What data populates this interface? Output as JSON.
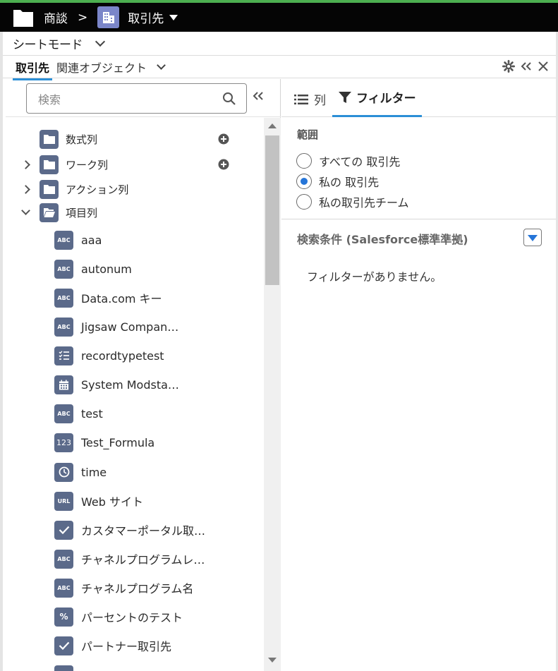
{
  "header": {
    "breadcrumb_root": "商談",
    "breadcrumb_sep": ">",
    "object_name": "取引先"
  },
  "sheet_mode": {
    "label": "シートモード"
  },
  "object_tabs": {
    "active": "取引先",
    "related": "関連オブジェクト"
  },
  "left": {
    "search_placeholder": "検索",
    "folders": [
      {
        "label": "数式列"
      },
      {
        "label": "ワーク列"
      },
      {
        "label": "アクション列"
      },
      {
        "label": "項目列"
      }
    ],
    "fields": [
      {
        "label": "aaa",
        "icon": "ABC"
      },
      {
        "label": "autonum",
        "icon": "ABC"
      },
      {
        "label": "Data.com キー",
        "icon": "ABC"
      },
      {
        "label": "Jigsaw Compan…",
        "icon": "ABC"
      },
      {
        "label": "recordtypetest",
        "icon": "list-check-icon"
      },
      {
        "label": "System Modsta…",
        "icon": "calendar-icon"
      },
      {
        "label": "test",
        "icon": "ABC"
      },
      {
        "label": "Test_Formula",
        "icon": "123"
      },
      {
        "label": "time",
        "icon": "clock-icon"
      },
      {
        "label": "Web サイト",
        "icon": "URL"
      },
      {
        "label": "カスタマーポータル取…",
        "icon": "checkbox-icon"
      },
      {
        "label": "チャネルプログラムレ…",
        "icon": "ABC"
      },
      {
        "label": "チャネルプログラム名",
        "icon": "ABC"
      },
      {
        "label": "パーセントのテスト",
        "icon": "%"
      },
      {
        "label": "パートナー取引先",
        "icon": "checkbox-icon"
      }
    ]
  },
  "right": {
    "tab_columns": "列",
    "tab_filter": "フィルター",
    "scope_title": "範囲",
    "scope_options": [
      {
        "label": "すべての 取引先",
        "checked": false
      },
      {
        "label": "私の 取引先",
        "checked": true
      },
      {
        "label": "私の取引先チーム",
        "checked": false
      }
    ],
    "conditions_title": "検索条件 (Salesforce標準準拠)",
    "no_filter_text": "フィルターがありません。"
  },
  "colors": {
    "accent": "#2b8fd6",
    "icon_bg": "#5b6a8a",
    "radio_checked": "#2575d8",
    "top_bar": "#050505",
    "top_accent": "#4caf50"
  }
}
